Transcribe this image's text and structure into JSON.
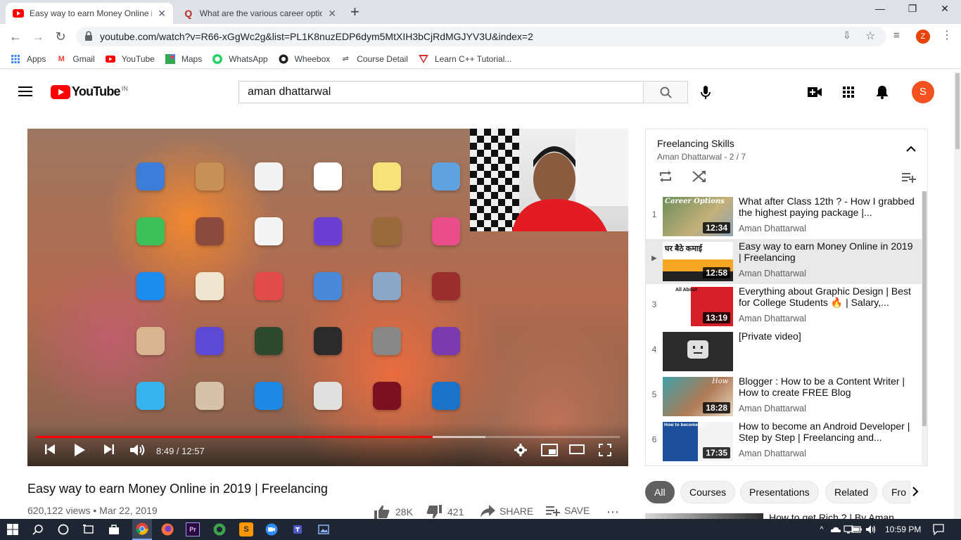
{
  "browser": {
    "tabs": [
      {
        "title": "Easy way to earn Money Online in",
        "icon": "youtube-icon",
        "active": true
      },
      {
        "title": "What are the various career optio",
        "icon": "quora-icon",
        "active": false
      }
    ],
    "new_tab_label": "+",
    "url": "youtube.com/watch?v=R66-xGgWc2g&list=PL1K8nuzEDP6dym5MtXIH3bCjRdMGJYV3U&index=2",
    "profile_initial": "Z",
    "bookmarks": [
      {
        "label": "Apps",
        "icon": "apps-grid-icon"
      },
      {
        "label": "Gmail",
        "icon": "gmail-icon"
      },
      {
        "label": "YouTube",
        "icon": "youtube-icon"
      },
      {
        "label": "Maps",
        "icon": "maps-icon"
      },
      {
        "label": "WhatsApp",
        "icon": "whatsapp-icon"
      },
      {
        "label": "Wheebox",
        "icon": "globe-icon"
      },
      {
        "label": "Course Detail",
        "icon": "course-icon"
      },
      {
        "label": "Learn C++ Tutorial...",
        "icon": "tutorial-icon"
      }
    ]
  },
  "youtube": {
    "logo_text": "YouTube",
    "logo_region": "IN",
    "search_value": "aman dhattarwal",
    "avatar_initial": "S",
    "brand_red": "#ff0000"
  },
  "player": {
    "time_current": "8:49",
    "time_separator": " / ",
    "time_total": "12:57",
    "progress_fraction": 0.68,
    "buffered_fraction": 0.77
  },
  "video": {
    "title": "Easy way to earn Money Online in 2019 | Freelancing",
    "meta": "620,122 views • Mar 22, 2019",
    "likes": "28K",
    "dislikes": "421",
    "share_label": "SHARE",
    "save_label": "SAVE"
  },
  "playlist": {
    "title": "Freelancing Skills",
    "subtitle": "Aman Dhattarwal - 2 / 7",
    "items": [
      {
        "index": "1",
        "title": "What after Class 12th ? - How I grabbed the highest paying package |...",
        "channel": "Aman Dhattarwal",
        "duration": "12:34",
        "thumb_text": "Career Options"
      },
      {
        "index": "▶",
        "title": "Easy way to earn Money Online in 2019 | Freelancing",
        "channel": "Aman Dhattarwal",
        "duration": "12:58",
        "thumb_text": "घर बैठे कमाई"
      },
      {
        "index": "3",
        "title": "Everything about Graphic Design | Best for College Students 🔥 | Salary,...",
        "channel": "Aman Dhattarwal",
        "duration": "13:19",
        "thumb_text": "All About"
      },
      {
        "index": "4",
        "title": "[Private video]",
        "channel": "",
        "duration": "",
        "thumb_text": ""
      },
      {
        "index": "5",
        "title": "Blogger : How to be a Content Writer | How to create FREE Blog",
        "channel": "Aman Dhattarwal",
        "duration": "18:28",
        "thumb_text": "How"
      },
      {
        "index": "6",
        "title": "How to become an Android Developer | Step by Step | Freelancing and...",
        "channel": "Aman Dhattarwal",
        "duration": "17:35",
        "thumb_text": "How to become an"
      }
    ]
  },
  "chips": [
    "All",
    "Courses",
    "Presentations",
    "Related",
    "Fro"
  ],
  "next_video_title": "How to get Rich ? | By Aman",
  "taskbar": {
    "clock": "10:59 PM"
  }
}
